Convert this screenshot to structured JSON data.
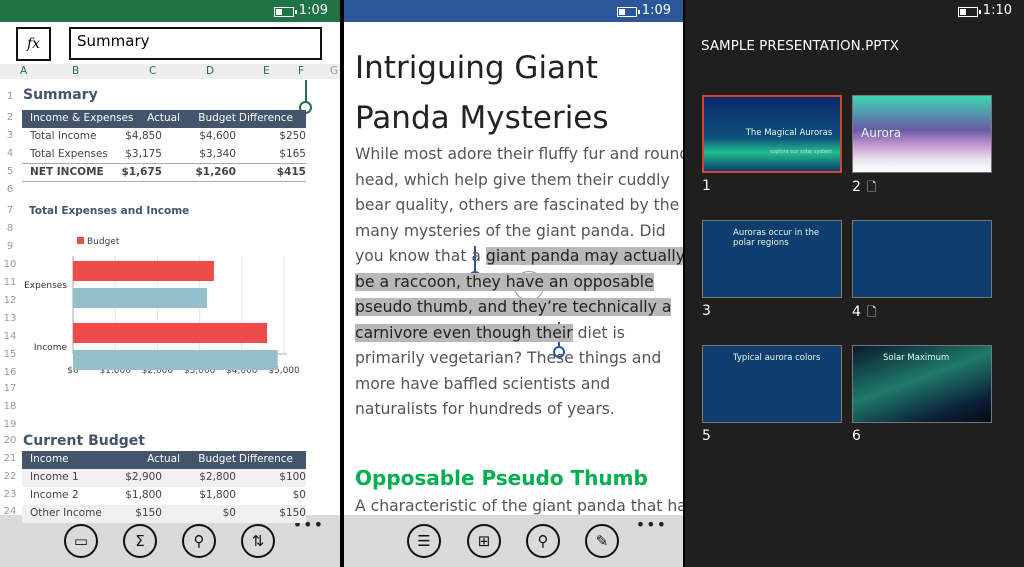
{
  "excel": {
    "status": {
      "time": "1:09",
      "color": "#217346"
    },
    "formula": {
      "fx_label": "fx",
      "value": "Summary"
    },
    "columns": [
      "A",
      "B",
      "C",
      "D",
      "E",
      "F",
      "G"
    ],
    "rows": [
      "1",
      "2",
      "3",
      "4",
      "5",
      "6",
      "7",
      "8",
      "9",
      "10",
      "11",
      "12",
      "13",
      "14",
      "15",
      "16",
      "17",
      "18",
      "19",
      "20",
      "21",
      "22",
      "23",
      "24"
    ],
    "summary": {
      "title": "Summary",
      "headers": [
        "Income & Expenses",
        "Actual",
        "Budget",
        "Difference"
      ],
      "data": [
        [
          "Total Income",
          "$4,850",
          "$4,600",
          "$250"
        ],
        [
          "Total Expenses",
          "$3,175",
          "$3,340",
          "$165"
        ],
        [
          "NET INCOME",
          "$1,675",
          "$1,260",
          "$415"
        ]
      ]
    },
    "chart_title": "Total Expenses and Income",
    "current": {
      "title": "Current Budget",
      "headers": [
        "Income",
        "Actual",
        "Budget",
        "Difference"
      ],
      "data": [
        [
          "Income 1",
          "$2,900",
          "$2,800",
          "$100"
        ],
        [
          "Income 2",
          "$1,800",
          "$1,800",
          "$0"
        ],
        [
          "Other Income",
          "$150",
          "$0",
          "$150"
        ]
      ]
    },
    "appbar": [
      "comment-icon",
      "sum-icon",
      "search-icon",
      "sort-icon"
    ],
    "more": "•••"
  },
  "chart_data": {
    "type": "bar",
    "orientation": "horizontal",
    "title": "Total Expenses and Income",
    "categories": [
      "Expenses",
      "Income"
    ],
    "series": [
      {
        "name": "Budget",
        "values": [
          3340,
          4600
        ],
        "color": "#f04b4b"
      },
      {
        "values": [
          3175,
          4850
        ],
        "color": "#94bfcb"
      }
    ],
    "xticks": [
      "$0",
      "$1,000",
      "$2,000",
      "$3,000",
      "$4,000",
      "$5,000"
    ],
    "xlim": [
      0,
      5000
    ],
    "legend": "top-left",
    "grid": true
  },
  "word": {
    "status": {
      "time": "1:09",
      "color": "#2b579a"
    },
    "title_lines": [
      "Intriguing Giant",
      "Panda Mysteries"
    ],
    "lines": [
      {
        "pre": "While most adore their fluffy fur and round"
      },
      {
        "pre": "head, which help give them their cuddly"
      },
      {
        "pre": "bear quality, others are fascinated by the"
      },
      {
        "pre": "many mysteries of the giant panda. Did"
      },
      {
        "pre": "you know that a ",
        "sel": "giant panda may actually"
      },
      {
        "sel": "be a raccoon, they have an opposable"
      },
      {
        "sel": "pseudo thumb, and they’re technically a"
      },
      {
        "sel": "carnivore even though their",
        "post": " diet is"
      },
      {
        "pre": "primarily vegetarian? These things and"
      },
      {
        "pre": "more have baffled scientists and"
      },
      {
        "pre": "naturalists for hundreds of years."
      }
    ],
    "heading": "Opposable Pseudo Thumb",
    "heading_color": "#00b050",
    "next_line": "A characteristic of the giant panda that has",
    "appbar": [
      "outline-icon",
      "new-comment-icon",
      "search-icon",
      "edit-pen-icon"
    ],
    "more": "•••"
  },
  "ppt": {
    "status": {
      "time": "1:10"
    },
    "title": "SAMPLE PRESENTATION.PPTX",
    "slides": [
      {
        "num": "1",
        "title": "The Magical Auroras",
        "sub": "explore our solar system",
        "selected": true,
        "notes": false
      },
      {
        "num": "2",
        "title": "Aurora",
        "notes": true
      },
      {
        "num": "3",
        "title": "Auroras occur in the polar regions",
        "notes": false
      },
      {
        "num": "4",
        "title": "",
        "notes": true
      },
      {
        "num": "5",
        "title": "Typical aurora colors",
        "notes": false
      },
      {
        "num": "6",
        "title": "Solar Maximum",
        "notes": false
      }
    ],
    "accent": "#d24726"
  }
}
